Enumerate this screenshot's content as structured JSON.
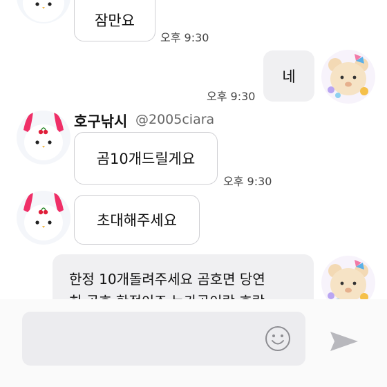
{
  "messages": [
    {
      "id": "m1",
      "text": "잠만요",
      "time": "오후 9:30"
    },
    {
      "id": "m2",
      "text": "네",
      "time": "오후 9:30"
    },
    {
      "id": "m3",
      "sender": "호구낚시",
      "handle": "@2005ciara",
      "text": "곰10개드릴게요",
      "time": "오후 9:30"
    },
    {
      "id": "m4",
      "text": "초대해주세요"
    },
    {
      "id": "m5",
      "text_line1": "한정 10개돌려주세요 곰호면 당연",
      "text_line2": "히 곰호 한정이죠 누가곰이랑 호랑"
    }
  ],
  "icons": {
    "emoji": "smiley-icon",
    "send": "send-arrow-icon"
  },
  "colors": {
    "incoming_bubble": "#ffffff",
    "outgoing_bubble": "#f0f0f2",
    "input_bg": "#ececef",
    "time_text": "#444444"
  }
}
